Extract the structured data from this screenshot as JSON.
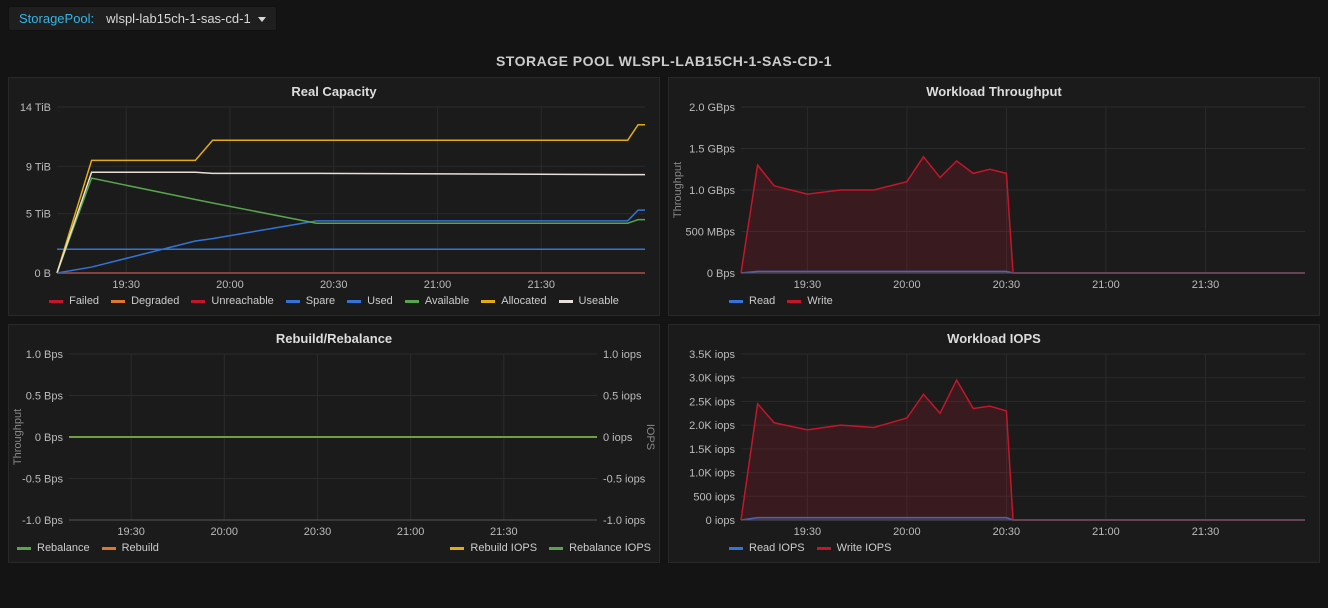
{
  "header": {
    "variable_label": "StoragePool:",
    "variable_value": "wlspl-lab15ch-1-sas-cd-1"
  },
  "page": {
    "title": "STORAGE POOL WLSPL-LAB15CH-1-SAS-CD-1"
  },
  "time_axis": {
    "ticks": [
      "19:30",
      "20:00",
      "20:30",
      "21:00",
      "21:30"
    ],
    "range_minutes": [
      0,
      170
    ]
  },
  "colors": {
    "red": "#c4162a",
    "orange": "#e0752d",
    "blue": "#3274d9",
    "green": "#56a64b",
    "yellow": "#e5ac0e",
    "white": "#e8e0d8",
    "darkred": "#8a1a1f"
  },
  "chart_data": [
    {
      "id": "real_capacity",
      "title": "Real Capacity",
      "type": "line",
      "xlabel": "",
      "ylabel": "",
      "y_ticks": [
        0,
        5,
        9,
        14
      ],
      "y_tick_labels": [
        "0 B",
        "5 TiB",
        "9 TiB",
        "14 TiB"
      ],
      "ylim": [
        0,
        14
      ],
      "x": [
        0,
        10,
        40,
        45,
        75,
        165,
        168,
        170
      ],
      "series": [
        {
          "name": "Failed",
          "color": "red",
          "values": [
            0,
            0,
            0,
            0,
            0,
            0,
            0,
            0
          ]
        },
        {
          "name": "Degraded",
          "color": "orange",
          "values": [
            0,
            0,
            0,
            0,
            0,
            0,
            0,
            0
          ]
        },
        {
          "name": "Unreachable",
          "color": "red",
          "values": [
            0,
            0,
            0,
            0,
            0,
            0,
            0,
            0
          ]
        },
        {
          "name": "Spare",
          "color": "blue",
          "values": [
            2,
            2,
            2,
            2,
            2,
            2,
            2,
            2
          ]
        },
        {
          "name": "Used",
          "color": "blue",
          "values": [
            0,
            0.5,
            2.7,
            2.9,
            4.4,
            4.4,
            5.3,
            5.3
          ]
        },
        {
          "name": "Available",
          "color": "green",
          "values": [
            0,
            8.0,
            6.2,
            5.9,
            4.2,
            4.2,
            4.5,
            4.5
          ]
        },
        {
          "name": "Allocated",
          "color": "yellow",
          "values": [
            0,
            9.5,
            9.5,
            11.2,
            11.2,
            11.2,
            12.5,
            12.5
          ]
        },
        {
          "name": "Useable",
          "color": "white",
          "values": [
            0,
            8.5,
            8.5,
            8.4,
            8.4,
            8.3,
            8.3,
            8.3
          ]
        }
      ]
    },
    {
      "id": "workload_throughput",
      "title": "Workload Throughput",
      "type": "area",
      "ylabel": "Throughput",
      "y_ticks": [
        0,
        0.5,
        1.0,
        1.5,
        2.0
      ],
      "y_tick_labels": [
        "0 Bps",
        "500 MBps",
        "1.0 GBps",
        "1.5 GBps",
        "2.0 GBps"
      ],
      "ylim": [
        0,
        2.0
      ],
      "x": [
        0,
        5,
        10,
        20,
        30,
        40,
        50,
        55,
        60,
        65,
        70,
        75,
        80,
        82,
        85,
        170
      ],
      "series": [
        {
          "name": "Read",
          "color": "blue",
          "fill": true,
          "values": [
            0,
            0.02,
            0.02,
            0.02,
            0.02,
            0.02,
            0.02,
            0.02,
            0.02,
            0.02,
            0.02,
            0.02,
            0.02,
            0,
            0,
            0
          ]
        },
        {
          "name": "Write",
          "color": "red",
          "fill": true,
          "values": [
            0,
            1.3,
            1.05,
            0.95,
            1.0,
            1.0,
            1.1,
            1.4,
            1.15,
            1.35,
            1.2,
            1.25,
            1.2,
            0,
            0,
            0
          ]
        }
      ]
    },
    {
      "id": "rebuild_rebalance",
      "title": "Rebuild/Rebalance",
      "type": "line",
      "ylabel_left": "Throughput",
      "ylabel_right": "IOPS",
      "y_ticks": [
        -1.0,
        -0.5,
        0,
        0.5,
        1.0
      ],
      "y_tick_labels_left": [
        "-1.0 Bps",
        "-0.5 Bps",
        "0 Bps",
        "0.5 Bps",
        "1.0 Bps"
      ],
      "y_tick_labels_right": [
        "-1.0 iops",
        "-0.5 iops",
        "0 iops",
        "0.5 iops",
        "1.0 iops"
      ],
      "ylim": [
        -1.0,
        1.0
      ],
      "x": [
        0,
        170
      ],
      "series": [
        {
          "name": "Rebalance",
          "color": "green",
          "values": [
            0,
            0
          ]
        },
        {
          "name": "Rebuild",
          "color": "orange",
          "values": [
            0,
            0
          ]
        },
        {
          "name": "Rebuild IOPS",
          "color": "yellow",
          "axis": "right",
          "values": [
            0,
            0
          ]
        },
        {
          "name": "Rebalance IOPS",
          "color": "green",
          "axis": "right",
          "values": [
            0,
            0
          ]
        }
      ],
      "legend_left": [
        "Rebalance",
        "Rebuild"
      ],
      "legend_right": [
        "Rebuild IOPS",
        "Rebalance IOPS"
      ]
    },
    {
      "id": "workload_iops",
      "title": "Workload IOPS",
      "type": "area",
      "ylabel": "",
      "y_ticks": [
        0,
        500,
        1000,
        1500,
        2000,
        2500,
        3000,
        3500
      ],
      "y_tick_labels": [
        "0 iops",
        "500 iops",
        "1.0K iops",
        "1.5K iops",
        "2.0K iops",
        "2.5K iops",
        "3.0K iops",
        "3.5K iops"
      ],
      "ylim": [
        0,
        3500
      ],
      "x": [
        0,
        5,
        10,
        20,
        30,
        40,
        50,
        55,
        60,
        65,
        70,
        75,
        80,
        82,
        85,
        170
      ],
      "series": [
        {
          "name": "Read IOPS",
          "color": "blue",
          "fill": true,
          "values": [
            0,
            50,
            50,
            50,
            50,
            50,
            50,
            50,
            50,
            50,
            50,
            50,
            50,
            0,
            0,
            0
          ]
        },
        {
          "name": "Write IOPS",
          "color": "red",
          "fill": true,
          "values": [
            0,
            2450,
            2050,
            1900,
            2000,
            1950,
            2150,
            2650,
            2250,
            2950,
            2350,
            2400,
            2300,
            0,
            0,
            0
          ]
        }
      ]
    }
  ]
}
